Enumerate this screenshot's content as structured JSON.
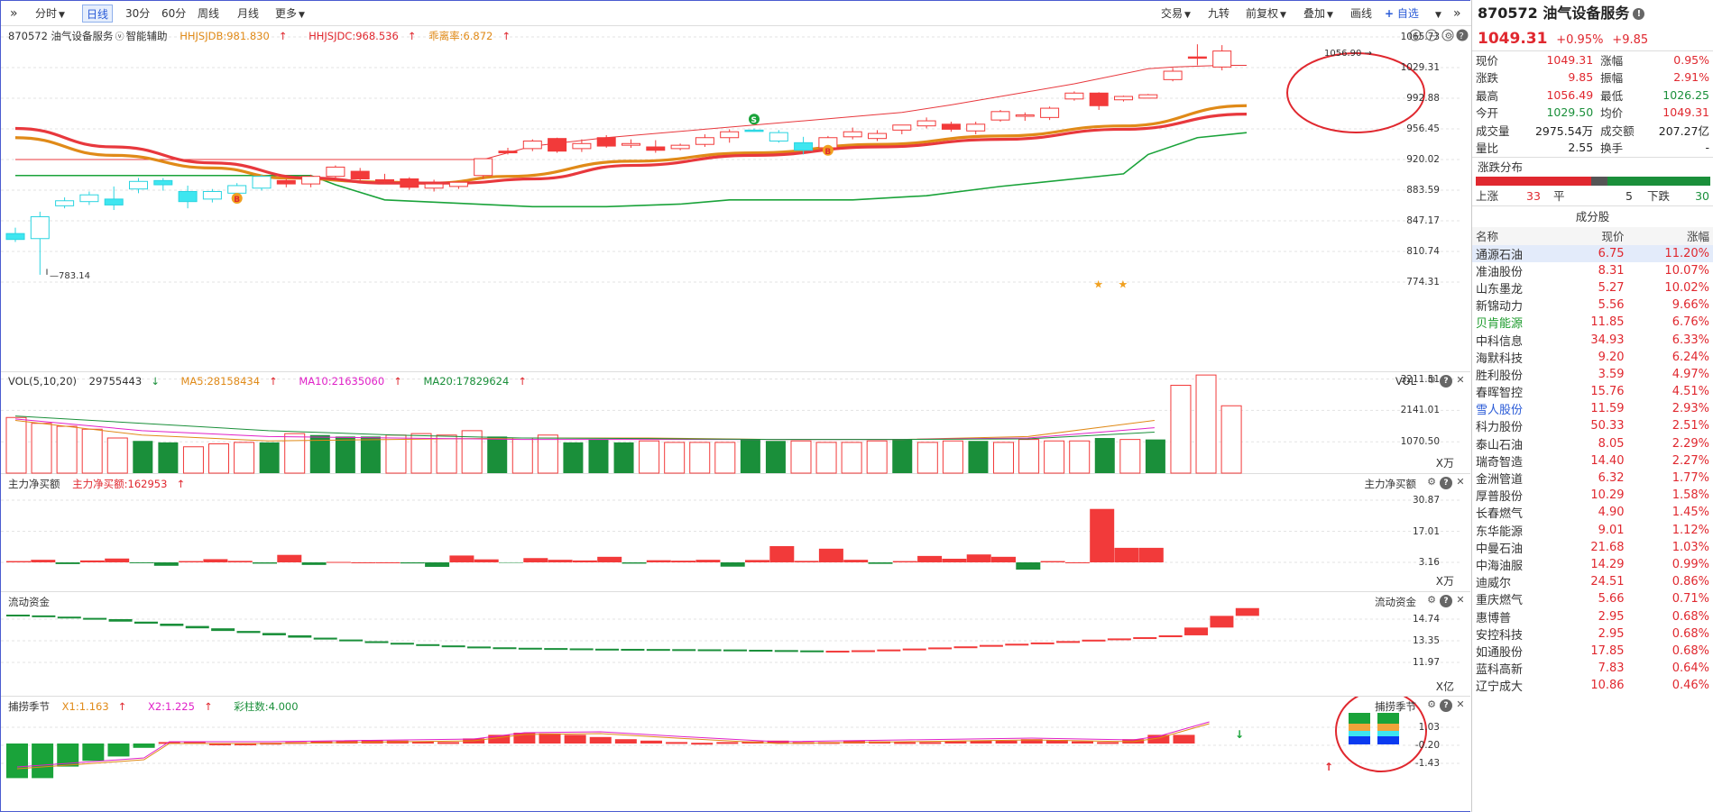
{
  "toolbar": {
    "left": [
      "分时",
      "日线",
      "30分",
      "60分",
      "周线",
      "月线",
      "更多"
    ],
    "right": [
      "交易",
      "九转",
      "前复权",
      "叠加",
      "画线",
      "自选"
    ]
  },
  "main": {
    "title": "870572 油气设备服务",
    "assist": "智能辅助",
    "ind1": "HHJSJDB:981.830",
    "ind2": "HHJSJDC:968.536",
    "ind3": "乖离率:6.872",
    "y_labels": [
      "1065.73",
      "1029.31",
      "992.88",
      "956.45",
      "920.02",
      "883.59",
      "847.17",
      "810.74",
      "774.31"
    ],
    "high_label": "1056.90",
    "low_label": "783.14",
    "b_mark": "B",
    "s_mark": "S"
  },
  "vol": {
    "title": "VOL(5,10,20)",
    "value": "29755443",
    "ma5": "MA5:28158434",
    "ma10": "MA10:21635060",
    "ma20": "MA20:17829624",
    "label": "VOL",
    "y_labels": [
      "3211.51",
      "2141.01",
      "1070.50"
    ],
    "unit": "X万"
  },
  "net": {
    "title": "主力净买额",
    "value": "主力净买额:162953",
    "label": "主力净买额",
    "y_labels": [
      "30.87",
      "17.01",
      "3.16"
    ],
    "unit": "X万"
  },
  "flow": {
    "title": "流动资金",
    "label": "流动资金",
    "y_labels": [
      "14.74",
      "13.35",
      "11.97"
    ],
    "unit": "X亿"
  },
  "season": {
    "title": "捕捞季节",
    "x1": "X1:1.163",
    "x2": "X2:1.225",
    "cz": "彩柱数:4.000",
    "label": "捕捞季节",
    "y_labels": [
      "1.03",
      "-0.20",
      "-1.43"
    ]
  },
  "colors": {
    "up": "#f23a3a",
    "down": "#1a8f3a",
    "cyan": "#3ee6f0",
    "orange": "#e08a18",
    "ma_red": "#e8383d",
    "green_line": "#1aa33a",
    "magenta": "#e021c8"
  },
  "quote": {
    "code_name": "870572 油气设备服务",
    "price": "1049.31",
    "pct": "+0.95%",
    "chg": "+9.85",
    "rows": [
      [
        "现价",
        "1049.31",
        "涨幅",
        "0.95%"
      ],
      [
        "涨跌",
        "9.85",
        "振幅",
        "2.91%"
      ],
      [
        "最高",
        "1056.49",
        "最低",
        "1026.25"
      ],
      [
        "今开",
        "1029.50",
        "均价",
        "1049.31"
      ],
      [
        "成交量",
        "2975.54万",
        "成交额",
        "207.27亿"
      ],
      [
        "量比",
        "2.55",
        "换手",
        "-"
      ]
    ]
  },
  "dist": {
    "title": "涨跌分布",
    "up_label": "上涨",
    "up": "33",
    "flat_label": "平",
    "flat": "5",
    "down_label": "下跌",
    "down": "30"
  },
  "components": {
    "title": "成分股",
    "headers": [
      "名称",
      "现价",
      "涨幅"
    ],
    "rows": [
      [
        "通源石油",
        "6.75",
        "11.20%"
      ],
      [
        "准油股份",
        "8.31",
        "10.07%"
      ],
      [
        "山东墨龙",
        "5.27",
        "10.02%"
      ],
      [
        "新锦动力",
        "5.56",
        "9.66%"
      ],
      [
        "贝肯能源",
        "11.85",
        "6.76%"
      ],
      [
        "中科信息",
        "34.93",
        "6.33%"
      ],
      [
        "海默科技",
        "9.20",
        "6.24%"
      ],
      [
        "胜利股份",
        "3.59",
        "4.97%"
      ],
      [
        "春晖智控",
        "15.76",
        "4.51%"
      ],
      [
        "雪人股份",
        "11.59",
        "2.93%"
      ],
      [
        "科力股份",
        "50.33",
        "2.51%"
      ],
      [
        "泰山石油",
        "8.05",
        "2.29%"
      ],
      [
        "瑞奇智造",
        "14.40",
        "2.27%"
      ],
      [
        "金洲管道",
        "6.32",
        "1.77%"
      ],
      [
        "厚普股份",
        "10.29",
        "1.58%"
      ],
      [
        "长春燃气",
        "4.90",
        "1.45%"
      ],
      [
        "东华能源",
        "9.01",
        "1.12%"
      ],
      [
        "中曼石油",
        "21.68",
        "1.03%"
      ],
      [
        "中海油服",
        "14.29",
        "0.99%"
      ],
      [
        "迪威尔",
        "24.51",
        "0.86%"
      ],
      [
        "重庆燃气",
        "5.66",
        "0.71%"
      ],
      [
        "惠博普",
        "2.95",
        "0.68%"
      ],
      [
        "安控科技",
        "2.95",
        "0.68%"
      ],
      [
        "如通股份",
        "17.85",
        "0.68%"
      ],
      [
        "蓝科高新",
        "7.83",
        "0.64%"
      ],
      [
        "辽宁成大",
        "10.86",
        "0.46%"
      ]
    ],
    "name_colors": {
      "4": "#1a9a2a",
      "9": "#2a5bd7"
    }
  },
  "candles": [
    [
      832,
      825,
      839,
      822
    ],
    [
      826,
      852,
      858,
      783
    ],
    [
      865,
      871,
      875,
      862
    ],
    [
      870,
      878,
      882,
      866
    ],
    [
      873,
      866,
      888,
      860
    ],
    [
      885,
      894,
      898,
      880
    ],
    [
      895,
      890,
      898,
      883
    ],
    [
      882,
      870,
      889,
      862
    ],
    [
      873,
      882,
      885,
      869
    ],
    [
      880,
      889,
      892,
      876
    ],
    [
      886,
      900,
      902,
      883
    ],
    [
      895,
      891,
      897,
      887
    ],
    [
      891,
      900,
      902,
      887
    ],
    [
      900,
      911,
      913,
      896
    ],
    [
      906,
      897,
      910,
      894
    ],
    [
      896,
      895,
      903,
      891
    ],
    [
      897,
      887,
      899,
      884
    ],
    [
      886,
      891,
      896,
      882
    ],
    [
      888,
      893,
      894,
      885
    ],
    [
      901,
      921,
      921,
      897
    ],
    [
      930,
      928,
      934,
      926
    ],
    [
      933,
      942,
      944,
      930
    ],
    [
      945,
      930,
      946,
      928
    ],
    [
      933,
      939,
      944,
      929
    ],
    [
      946,
      936,
      949,
      934
    ],
    [
      937,
      939,
      944,
      934
    ],
    [
      935,
      931,
      943,
      928
    ],
    [
      933,
      937,
      939,
      931
    ],
    [
      938,
      946,
      950,
      935
    ],
    [
      946,
      953,
      956,
      940
    ],
    [
      955,
      955,
      957,
      953
    ],
    [
      952,
      942,
      955,
      940
    ],
    [
      940,
      931,
      947,
      926
    ],
    [
      934,
      946,
      948,
      931
    ],
    [
      947,
      953,
      958,
      944
    ],
    [
      945,
      951,
      955,
      942
    ],
    [
      955,
      961,
      961,
      950
    ],
    [
      960,
      966,
      970,
      957
    ],
    [
      962,
      956,
      965,
      953
    ],
    [
      954,
      962,
      965,
      950
    ],
    [
      967,
      977,
      979,
      965
    ],
    [
      972,
      973,
      976,
      966
    ],
    [
      970,
      981,
      983,
      967
    ],
    [
      992,
      999,
      1001,
      990
    ],
    [
      999,
      984,
      1000,
      979
    ],
    [
      991,
      995,
      996,
      989
    ],
    [
      993,
      997,
      998,
      993
    ],
    [
      1015,
      1025,
      1029,
      1013
    ],
    [
      1042,
      1041,
      1057,
      1032
    ],
    [
      1030,
      1049,
      1056,
      1026
    ]
  ],
  "vol_bars": [
    [
      1900,
      1
    ],
    [
      1700,
      1
    ],
    [
      1600,
      1
    ],
    [
      1500,
      1
    ],
    [
      1200,
      1
    ],
    [
      1100,
      0
    ],
    [
      1050,
      0
    ],
    [
      900,
      1
    ],
    [
      1000,
      1
    ],
    [
      1050,
      1
    ],
    [
      1050,
      0
    ],
    [
      1350,
      1
    ],
    [
      1300,
      0
    ],
    [
      1250,
      0
    ],
    [
      1250,
      0
    ],
    [
      1300,
      1
    ],
    [
      1350,
      1
    ],
    [
      1300,
      1
    ],
    [
      1450,
      1
    ],
    [
      1250,
      0
    ],
    [
      1200,
      1
    ],
    [
      1300,
      1
    ],
    [
      1050,
      0
    ],
    [
      1150,
      0
    ],
    [
      1050,
      0
    ],
    [
      1100,
      1
    ],
    [
      1050,
      1
    ],
    [
      1050,
      1
    ],
    [
      1050,
      1
    ],
    [
      1150,
      0
    ],
    [
      1100,
      0
    ],
    [
      1100,
      1
    ],
    [
      1050,
      1
    ],
    [
      1050,
      1
    ],
    [
      1100,
      1
    ],
    [
      1150,
      0
    ],
    [
      1050,
      1
    ],
    [
      1100,
      1
    ],
    [
      1100,
      0
    ],
    [
      1050,
      1
    ],
    [
      1150,
      1
    ],
    [
      1100,
      1
    ],
    [
      1100,
      1
    ],
    [
      1200,
      0
    ],
    [
      1150,
      1
    ],
    [
      1150,
      0
    ],
    [
      3000,
      1
    ],
    [
      3350,
      1
    ],
    [
      2300,
      1
    ]
  ],
  "net_bars": [
    [
      0.6,
      -1
    ],
    [
      1.2,
      1
    ],
    [
      -0.8,
      -1
    ],
    [
      0.9,
      1
    ],
    [
      1.8,
      1
    ],
    [
      -0.4,
      -1
    ],
    [
      -1.6,
      -1
    ],
    [
      0.6,
      1
    ],
    [
      1.5,
      1
    ],
    [
      0.7,
      1
    ],
    [
      -0.6,
      -1
    ],
    [
      3.5,
      1
    ],
    [
      -1.2,
      -1
    ],
    [
      0.2,
      1
    ],
    [
      0,
      1
    ],
    [
      0,
      1
    ],
    [
      -0.5,
      -1
    ],
    [
      -2.1,
      -1
    ],
    [
      3.2,
      1
    ],
    [
      1.4,
      1
    ],
    [
      -0.2,
      -1
    ],
    [
      2.0,
      1
    ],
    [
      1.2,
      1
    ],
    [
      0.9,
      1
    ],
    [
      2.6,
      1
    ],
    [
      -0.6,
      -1
    ],
    [
      1.0,
      1
    ],
    [
      0.8,
      1
    ],
    [
      1.2,
      1
    ],
    [
      -2.0,
      -1
    ],
    [
      1.1,
      1
    ],
    [
      7.6,
      1
    ],
    [
      0.7,
      1
    ],
    [
      6.4,
      1
    ],
    [
      1.2,
      1
    ],
    [
      -0.7,
      -1
    ],
    [
      0.6,
      1
    ],
    [
      3.0,
      1
    ],
    [
      1.7,
      1
    ],
    [
      3.7,
      1
    ],
    [
      2.6,
      1
    ],
    [
      -3.4,
      -1
    ],
    [
      0.6,
      1
    ],
    [
      0,
      -1
    ],
    [
      25.0,
      1
    ],
    [
      6.8,
      1
    ],
    [
      6.8,
      1
    ]
  ],
  "flow_pts": [
    [
      0,
      14.98
    ],
    [
      1,
      14.9
    ],
    [
      2,
      14.82
    ],
    [
      3,
      14.74
    ],
    [
      4,
      14.58
    ],
    [
      5,
      14.45
    ],
    [
      6,
      14.3
    ],
    [
      7,
      14.15
    ],
    [
      8,
      13.98
    ],
    [
      9,
      13.85
    ],
    [
      10,
      13.7
    ],
    [
      11,
      13.55
    ],
    [
      12,
      13.43
    ],
    [
      13,
      13.32
    ],
    [
      14,
      13.22
    ],
    [
      15,
      13.13
    ],
    [
      16,
      13.05
    ],
    [
      17,
      12.98
    ],
    [
      18,
      12.93
    ],
    [
      19,
      12.9
    ],
    [
      20,
      12.88
    ],
    [
      21,
      12.86
    ],
    [
      22,
      12.84
    ],
    [
      23,
      12.83
    ],
    [
      24,
      12.82
    ],
    [
      25,
      12.81
    ],
    [
      26,
      12.8
    ],
    [
      27,
      12.79
    ],
    [
      28,
      12.77
    ],
    [
      29,
      12.75
    ],
    [
      30,
      12.73
    ],
    [
      31,
      12.7
    ],
    [
      32,
      12.71
    ],
    [
      33,
      12.74
    ],
    [
      34,
      12.79
    ],
    [
      35,
      12.85
    ],
    [
      36,
      12.92
    ],
    [
      37,
      12.99
    ],
    [
      38,
      13.08
    ],
    [
      39,
      13.16
    ],
    [
      40,
      13.24
    ],
    [
      41,
      13.33
    ],
    [
      42,
      13.42
    ],
    [
      43,
      13.5
    ],
    [
      44,
      13.58
    ],
    [
      45,
      13.7
    ],
    [
      46,
      14.2
    ],
    [
      47,
      14.95
    ],
    [
      48,
      15.45
    ]
  ]
}
